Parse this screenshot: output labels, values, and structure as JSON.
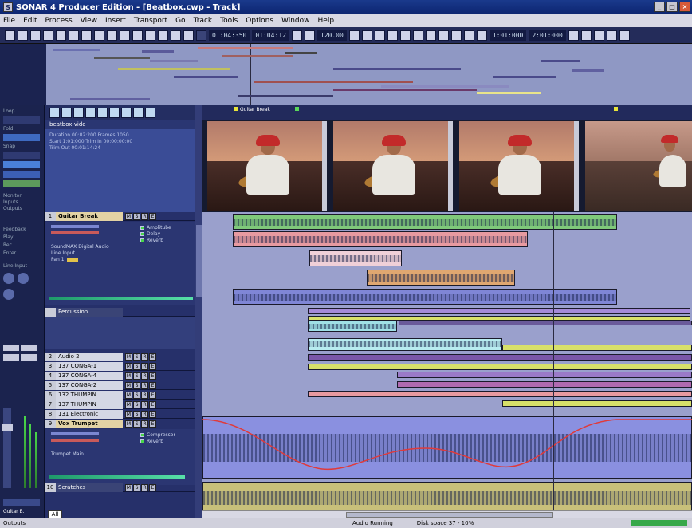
{
  "window": {
    "title": "SONAR 4 Producer Edition - [Beatbox.cwp - Track]",
    "app_icon": "sonar-app-icon"
  },
  "menu": [
    "File",
    "Edit",
    "Process",
    "View",
    "Insert",
    "Transport",
    "Go",
    "Track",
    "Tools",
    "Options",
    "Window",
    "Help"
  ],
  "toolbar": {
    "time_a": "01:04:350",
    "time_b": "01:04:12",
    "tempo": "120.00",
    "time_c": "1:01:000",
    "time_d": "2:01:000"
  },
  "left_panel": {
    "labels": [
      "Loop",
      "Fold",
      "Snap",
      "Feedback",
      "Play",
      "Rec",
      "Enter",
      "Line Input",
      "Monitor",
      "Inputs",
      "Outputs",
      "Guitar B."
    ]
  },
  "video_track": {
    "name": "beatbox-vide",
    "info_lines": [
      "Duration  00:02:200     Frames  1050",
      "Start  1:01:000   Trim In  00:00:00:00",
      "Trim Out  00:01:14:24"
    ]
  },
  "tracks": [
    {
      "num": "1",
      "name": "Guitar Break",
      "selected": true
    },
    {
      "num": "",
      "name": "Percussion",
      "dark": true
    },
    {
      "num": "2",
      "name": "Audio 2"
    },
    {
      "num": "3",
      "name": "137 CONGA-1"
    },
    {
      "num": "4",
      "name": "137 CONGA-4"
    },
    {
      "num": "5",
      "name": "137 CONGA-2"
    },
    {
      "num": "6",
      "name": "132 THUMPIN"
    },
    {
      "num": "7",
      "name": "137 THUMPIN"
    },
    {
      "num": "8",
      "name": "131 Electronic"
    },
    {
      "num": "9",
      "name": "Vox Trumpet",
      "selected": true
    },
    {
      "num": "10",
      "name": "Scratches",
      "dark": true
    }
  ],
  "guitar_fx": [
    "Amplitube",
    "Delay",
    "Reverb"
  ],
  "guitar_detail": [
    "SoundMAX Digital Audio",
    "Line Input",
    "Pan 1",
    "Vol"
  ],
  "vox_fx": [
    "Compressor",
    "Reverb"
  ],
  "vox_detail": [
    "Trumpet Main"
  ],
  "timeline": {
    "marker_1": "Guitar Break",
    "marker_2": ""
  },
  "track_btn_labels": [
    "M",
    "S",
    "R",
    "E"
  ],
  "tab_all": "All",
  "status": {
    "left": "Outputs",
    "center": "Audio Running",
    "mid2": "Audio Running",
    "right": "Disk space 37 - 10%"
  },
  "colors": {
    "green_clip": "#7fc97a",
    "pink_clip": "#e89aa0",
    "orange_clip": "#e0a770",
    "blue_clip": "#7f86d6",
    "purple_clip": "#a48ad8",
    "yellow_clip": "#d8e06a",
    "teal_clip": "#9fe0e6",
    "vox_clip": "#8a90e0",
    "scratch_clip": "#c8c07a"
  }
}
